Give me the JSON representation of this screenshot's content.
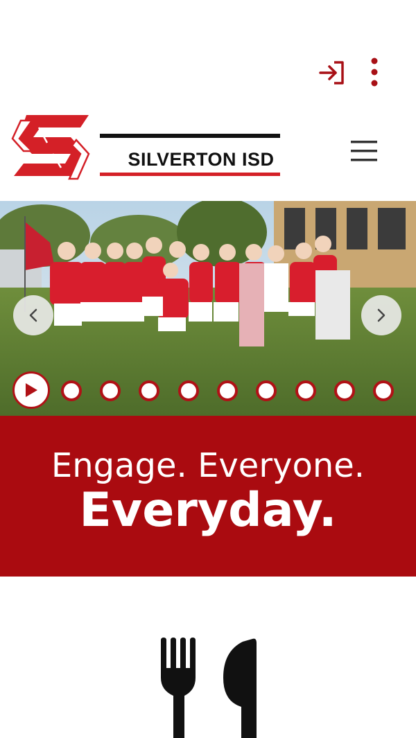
{
  "utility": {
    "signin_icon": "sign-in-icon",
    "more_icon": "vertical-dots-icon"
  },
  "header": {
    "district_name": "SILVERTON ISD",
    "menu_icon": "hamburger-menu-icon"
  },
  "slideshow": {
    "prev_icon": "chevron-left-icon",
    "next_icon": "chevron-right-icon",
    "play_icon": "play-icon",
    "dot_count": 9
  },
  "tagline": {
    "line1": "Engage. Everyone.",
    "line2": "Everyday."
  },
  "dining": {
    "icon": "fork-knife-icon"
  },
  "colors": {
    "brand_red": "#aa0b10",
    "accent_red": "#b01116",
    "white": "#ffffff"
  }
}
